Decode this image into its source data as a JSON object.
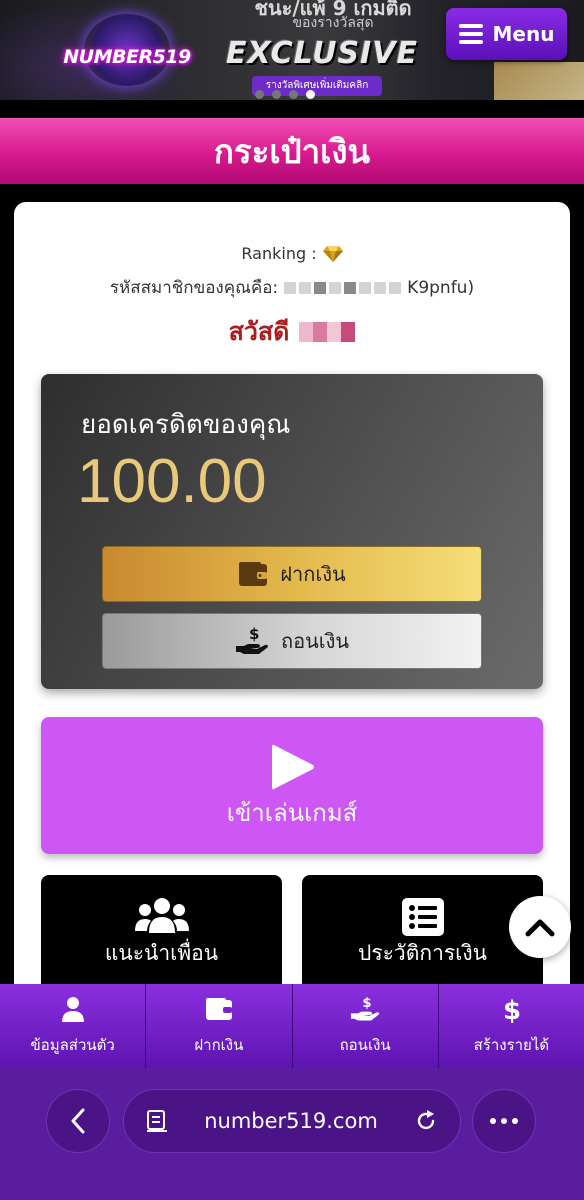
{
  "banner": {
    "brand": "NUMBER519",
    "line1": "ชนะ/แพ้ 9 เกมติด",
    "line2": "ของรางวัลสุด",
    "line3": "EXCLUSIVE",
    "line4": "รางวัลพิเศษเพิ่มเติมคลิก"
  },
  "header": {
    "menu_label": "Menu"
  },
  "page": {
    "title": "กระเป๋าเงิน"
  },
  "profile": {
    "ranking_label": "Ranking :",
    "member_label": "รหัสสมาชิกของคุณคือ:",
    "member_suffix": "K9pnfu)",
    "greeting": "สวัสดี"
  },
  "credit": {
    "label": "ยอดเครดิตของคุณ",
    "value": "100.00",
    "deposit_label": "ฝากเงิน",
    "withdraw_label": "ถอนเงิน"
  },
  "play": {
    "label": "เข้าเล่นเกมส์"
  },
  "tiles": [
    {
      "label": "แนะนำเพื่อน",
      "icon": "users-icon"
    },
    {
      "label": "ประวัติการเงิน",
      "icon": "list-icon"
    }
  ],
  "bottom_nav": [
    {
      "label": "ข้อมูลส่วนตัว",
      "icon": "user-icon"
    },
    {
      "label": "ฝากเงิน",
      "icon": "wallet-icon"
    },
    {
      "label": "ถอนเงิน",
      "icon": "hand-coin-icon"
    },
    {
      "label": "สร้างรายได้",
      "icon": "dollar-icon"
    }
  ],
  "browser": {
    "url": "number519.com"
  },
  "colors": {
    "title_bar": "#d8198f",
    "play_button": "#cd56f5",
    "credit_value": "#e8c97a",
    "greeting": "#b01b1b",
    "nav": "#7a22d0"
  }
}
